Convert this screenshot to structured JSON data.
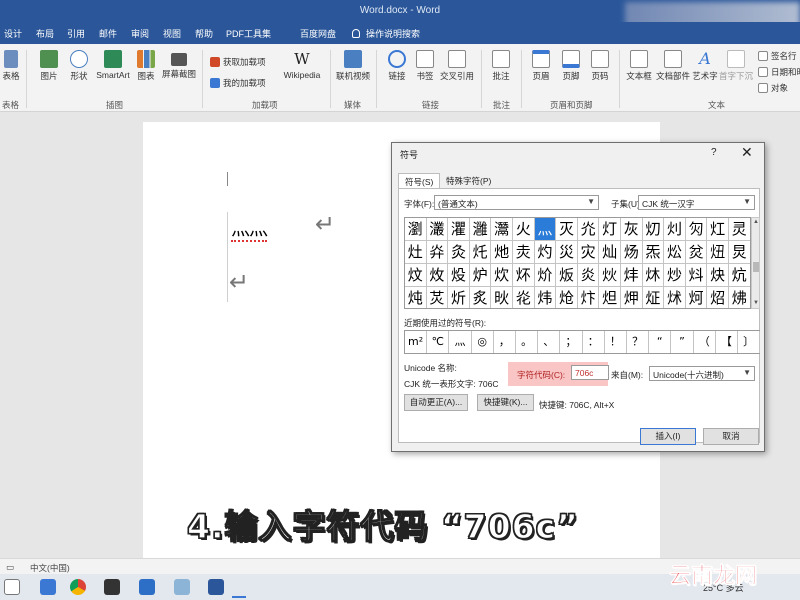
{
  "window": {
    "title": "Word.docx - Word"
  },
  "tabs": [
    "设计",
    "布局",
    "引用",
    "邮件",
    "审阅",
    "视图",
    "帮助",
    "PDF工具集",
    "百度网盘"
  ],
  "tell_me": "操作说明搜索",
  "ribbon": {
    "buttons": {
      "table": "表格",
      "picture": "图片",
      "shapes": "形状",
      "smartart": "SmartArt",
      "chart": "图表",
      "screenshot": "屏幕截图",
      "get_addins": "获取加载项",
      "my_addins": "我的加载项",
      "wikipedia": "Wikipedia",
      "online_video": "联机视频",
      "link": "链接",
      "bookmark": "书签",
      "crossref": "交叉引用",
      "comment": "批注",
      "header": "页眉",
      "footer": "页脚",
      "page_number": "页码",
      "textbox": "文本框",
      "quick_parts": "文档部件",
      "wordart": "艺术字",
      "dropcap": "首字下沉",
      "signature": "签名行",
      "datetime": "日期和时",
      "object": "对象"
    },
    "groups": [
      "表格",
      "插图",
      "加载项",
      "媒体",
      "链接",
      "批注",
      "页眉和页脚",
      "文本"
    ]
  },
  "document": {
    "sample_text": "灬灬"
  },
  "dialog": {
    "title": "符号",
    "help": "?",
    "close": "✕",
    "tabs": {
      "symbols": "符号(S)",
      "special": "特殊字符(P)"
    },
    "font_label": "字体(F):",
    "font_value": "(普通文本)",
    "subset_label": "子集(U):",
    "subset_value": "CJK 统一汉字",
    "grid_rows": [
      [
        "瀏",
        "灇",
        "灈",
        "灉",
        "灊",
        "火",
        "灬",
        "灭",
        "灮",
        "灯",
        "灰",
        "灱",
        "灲",
        "灳",
        "灴",
        "灵"
      ],
      [
        "灶",
        "灷",
        "灸",
        "灹",
        "灺",
        "灻",
        "灼",
        "災",
        "灾",
        "灿",
        "炀",
        "炁",
        "炂",
        "炃",
        "炄",
        "炅"
      ],
      [
        "炆",
        "炇",
        "炈",
        "炉",
        "炊",
        "炋",
        "炌",
        "炍",
        "炎",
        "炏",
        "炐",
        "炑",
        "炒",
        "炓",
        "炔",
        "炕"
      ],
      [
        "炖",
        "炗",
        "炘",
        "炙",
        "炚",
        "炛",
        "炜",
        "炝",
        "炞",
        "炟",
        "炠",
        "炡",
        "炢",
        "炣",
        "炤",
        "炥"
      ]
    ],
    "selected_symbol": "灬",
    "recent_label": "近期使用过的符号(R):",
    "recent_symbols": [
      "m²",
      "℃",
      "灬",
      "◎",
      "，",
      "。",
      "、",
      "；",
      "：",
      "！",
      "？",
      "“",
      "”",
      "（",
      "【",
      "〕"
    ],
    "unicode_name_label": "Unicode 名称:",
    "unicode_name_value": "CJK 统一表形文字: 706C",
    "char_code_label": "字符代码(C):",
    "char_code_value": "706c",
    "from_label": "来自(M):",
    "from_value": "Unicode(十六进制)",
    "autocorrect_button": "自动更正(A)...",
    "shortcut_button": "快捷键(K)...",
    "shortcut_text": "快捷键: 706C, Alt+X",
    "insert_button": "插入(I)",
    "cancel_button": "取消"
  },
  "caption": "4.输入字符代码 “706c”",
  "status_bar": {
    "language": "中文(中国)"
  },
  "taskbar": {
    "weather": "25°C 多云"
  },
  "watermark": "云南龙网"
}
